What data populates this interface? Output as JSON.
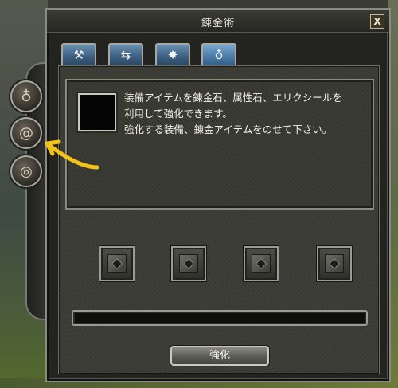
{
  "window": {
    "title": "錬金術",
    "close_label": "X"
  },
  "tabs": [
    {
      "label": "hammer",
      "glyph": "⚒"
    },
    {
      "label": "exchange",
      "glyph": "⇆"
    },
    {
      "label": "burst",
      "glyph": "✸"
    },
    {
      "label": "water",
      "glyph": "♁"
    }
  ],
  "side_buttons": [
    {
      "icon": "pouch-icon",
      "glyph": "♁"
    },
    {
      "icon": "swirl-icon",
      "glyph": "@"
    },
    {
      "icon": "shell-icon",
      "glyph": "◎"
    }
  ],
  "info": {
    "description_lines": [
      "装備アイテムを錬金石、属性石、エリクシールを",
      "利用して強化できます。",
      "強化する装備、錬金アイテムをのせて下さい。"
    ]
  },
  "actions": {
    "enhance_label": "強化"
  },
  "colors": {
    "annotation_arrow": "#f2c418",
    "tab_blue": "#4a7aa8"
  }
}
